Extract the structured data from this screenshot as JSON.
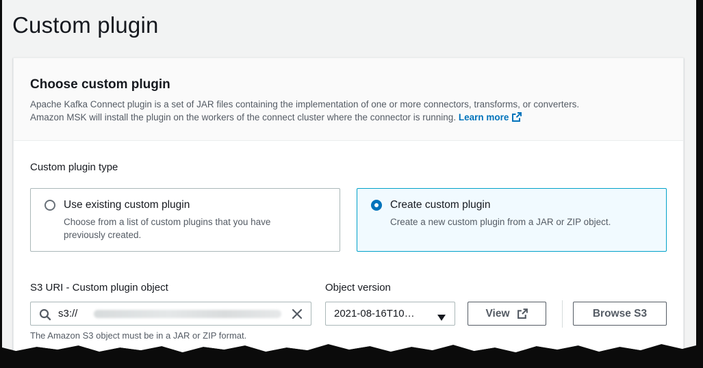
{
  "page": {
    "title": "Custom plugin"
  },
  "card": {
    "title": "Choose custom plugin",
    "description_line1": "Apache Kafka Connect plugin is a set of JAR files containing the implementation of one or more connectors, transforms, or converters.",
    "description_line2": "Amazon MSK will install the plugin on the workers of the connect cluster where the connector is running.",
    "learn_more": "Learn more"
  },
  "plugin_type": {
    "label": "Custom plugin type",
    "options": [
      {
        "title": "Use existing custom plugin",
        "desc_line1": "Choose from a list of custom plugins that you have",
        "desc_line2": "previously created.",
        "selected": false
      },
      {
        "title": "Create custom plugin",
        "desc_line1": "Create a new custom plugin from a JAR or ZIP object.",
        "selected": true
      }
    ]
  },
  "s3": {
    "label": "S3 URI - Custom plugin object",
    "value": "s3://",
    "hint": "The Amazon S3 object must be in a JAR or ZIP format."
  },
  "object_version": {
    "label": "Object version",
    "selected": "2021-08-16T10…"
  },
  "buttons": {
    "view": "View",
    "browse": "Browse S3"
  },
  "colors": {
    "accent": "#0073bb",
    "selected_bg": "#f1faff",
    "selected_border": "#00a1c9"
  },
  "icons": [
    "external-link-icon",
    "search-icon",
    "clear-icon",
    "caret-down-icon",
    "radio-icon"
  ]
}
